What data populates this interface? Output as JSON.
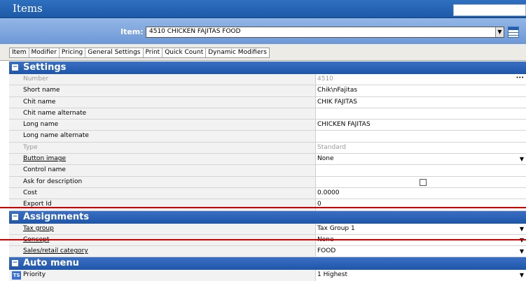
{
  "window": {
    "title": "Items"
  },
  "item_selector": {
    "label": "Item:",
    "value": "4510 CHICKEN FAJITAS FOOD"
  },
  "tabs": [
    "Item",
    "Modifier",
    "Pricing",
    "General Settings",
    "Print",
    "Quick Count",
    "Dynamic Modifiers"
  ],
  "sections": {
    "settings": {
      "title": "Settings",
      "rows": [
        {
          "name": "Number",
          "value": "4510"
        },
        {
          "name": "Short name",
          "value": "Chik\\nFajitas"
        },
        {
          "name": "Chit name",
          "value": "CHIK FAJITAS"
        },
        {
          "name": "Chit name alternate",
          "value": ""
        },
        {
          "name": "Long name",
          "value": "CHICKEN FAJITAS"
        },
        {
          "name": "Long name alternate",
          "value": ""
        },
        {
          "name": "Type",
          "value": "Standard"
        },
        {
          "name": "Button image",
          "value": "None"
        },
        {
          "name": "Control name",
          "value": ""
        },
        {
          "name": "Ask for description",
          "value": ""
        },
        {
          "name": "Cost",
          "value": "0.0000"
        },
        {
          "name": "Export Id",
          "value": "0"
        }
      ]
    },
    "assignments": {
      "title": "Assignments",
      "rows": [
        {
          "name": "Tax group",
          "value": "Tax Group 1"
        },
        {
          "name": "Concept",
          "value": "None"
        },
        {
          "name": "Sales/retail category",
          "value": "FOOD"
        }
      ]
    },
    "auto_menu": {
      "title": "Auto menu",
      "rows": [
        {
          "name": "Priority",
          "value": "1 Highest"
        }
      ]
    }
  },
  "icons": {
    "dropdown": "chevron-down-icon",
    "collapse": "minus-box-icon",
    "ellipsis": "ellipsis-icon",
    "grid": "grid-icon",
    "ts": "ts-icon"
  },
  "colors": {
    "header_blue": "#1e56aa",
    "annotation_red": "#d40000"
  }
}
